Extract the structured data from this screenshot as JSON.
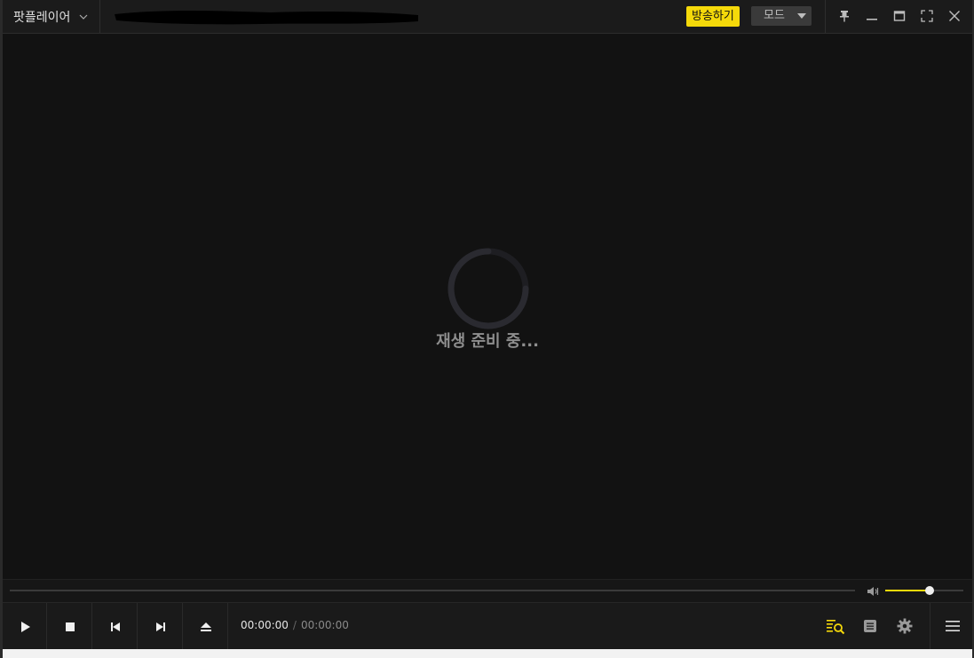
{
  "app": {
    "name": "팟플레이어"
  },
  "titlebar": {
    "broadcast_label": "방송하기",
    "mode_label": "모드"
  },
  "video": {
    "status_text": "재생 준비 중..."
  },
  "playback": {
    "current_time": "00:00:00",
    "separator": "/",
    "duration": "00:00:00",
    "seek_progress": 0,
    "volume_level": 0.57
  },
  "colors": {
    "accent": "#f5d90a",
    "background": "#121212",
    "bar": "#1a1a1a"
  },
  "icons": {
    "pin": "pin-icon",
    "minimize": "minimize-icon",
    "maximize": "maximize-icon",
    "fullscreen": "fullscreen-icon",
    "close": "close-icon",
    "play": "play-icon",
    "stop": "stop-icon",
    "previous": "previous-icon",
    "next": "next-icon",
    "eject": "eject-icon",
    "playlist_search": "playlist-search-icon",
    "chapter": "chapter-icon",
    "settings": "gear-icon",
    "menu": "hamburger-menu-icon",
    "volume": "speaker-icon"
  }
}
